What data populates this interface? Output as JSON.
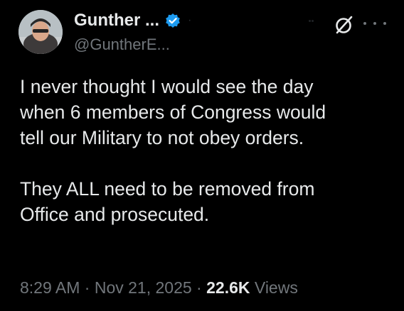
{
  "tweet": {
    "author": {
      "display_name": "Gunther ...",
      "handle": "@GuntherE...",
      "verified": true,
      "avatar_icon": "profile-photo-avatar"
    },
    "icons": {
      "grok": "grok-icon",
      "more": "more-options-icon",
      "verified_color": "#1d9bf0"
    },
    "body": {
      "line1": "I never thought I would see the day",
      "line2": "when 6 members of Congress would",
      "line3": "tell our Military to not obey orders.",
      "line4": "They ALL need to be removed from",
      "line5": "Office and prosecuted."
    },
    "meta": {
      "time": "8:29 AM",
      "separator1": " · ",
      "date": "Nov 21, 2025",
      "separator2": " · ",
      "views_count": "22.6K",
      "views_label": " Views"
    }
  },
  "colors": {
    "background": "#000000",
    "primary_text": "#e7e9ea",
    "secondary_text": "#71767b",
    "accent": "#1d9bf0"
  }
}
